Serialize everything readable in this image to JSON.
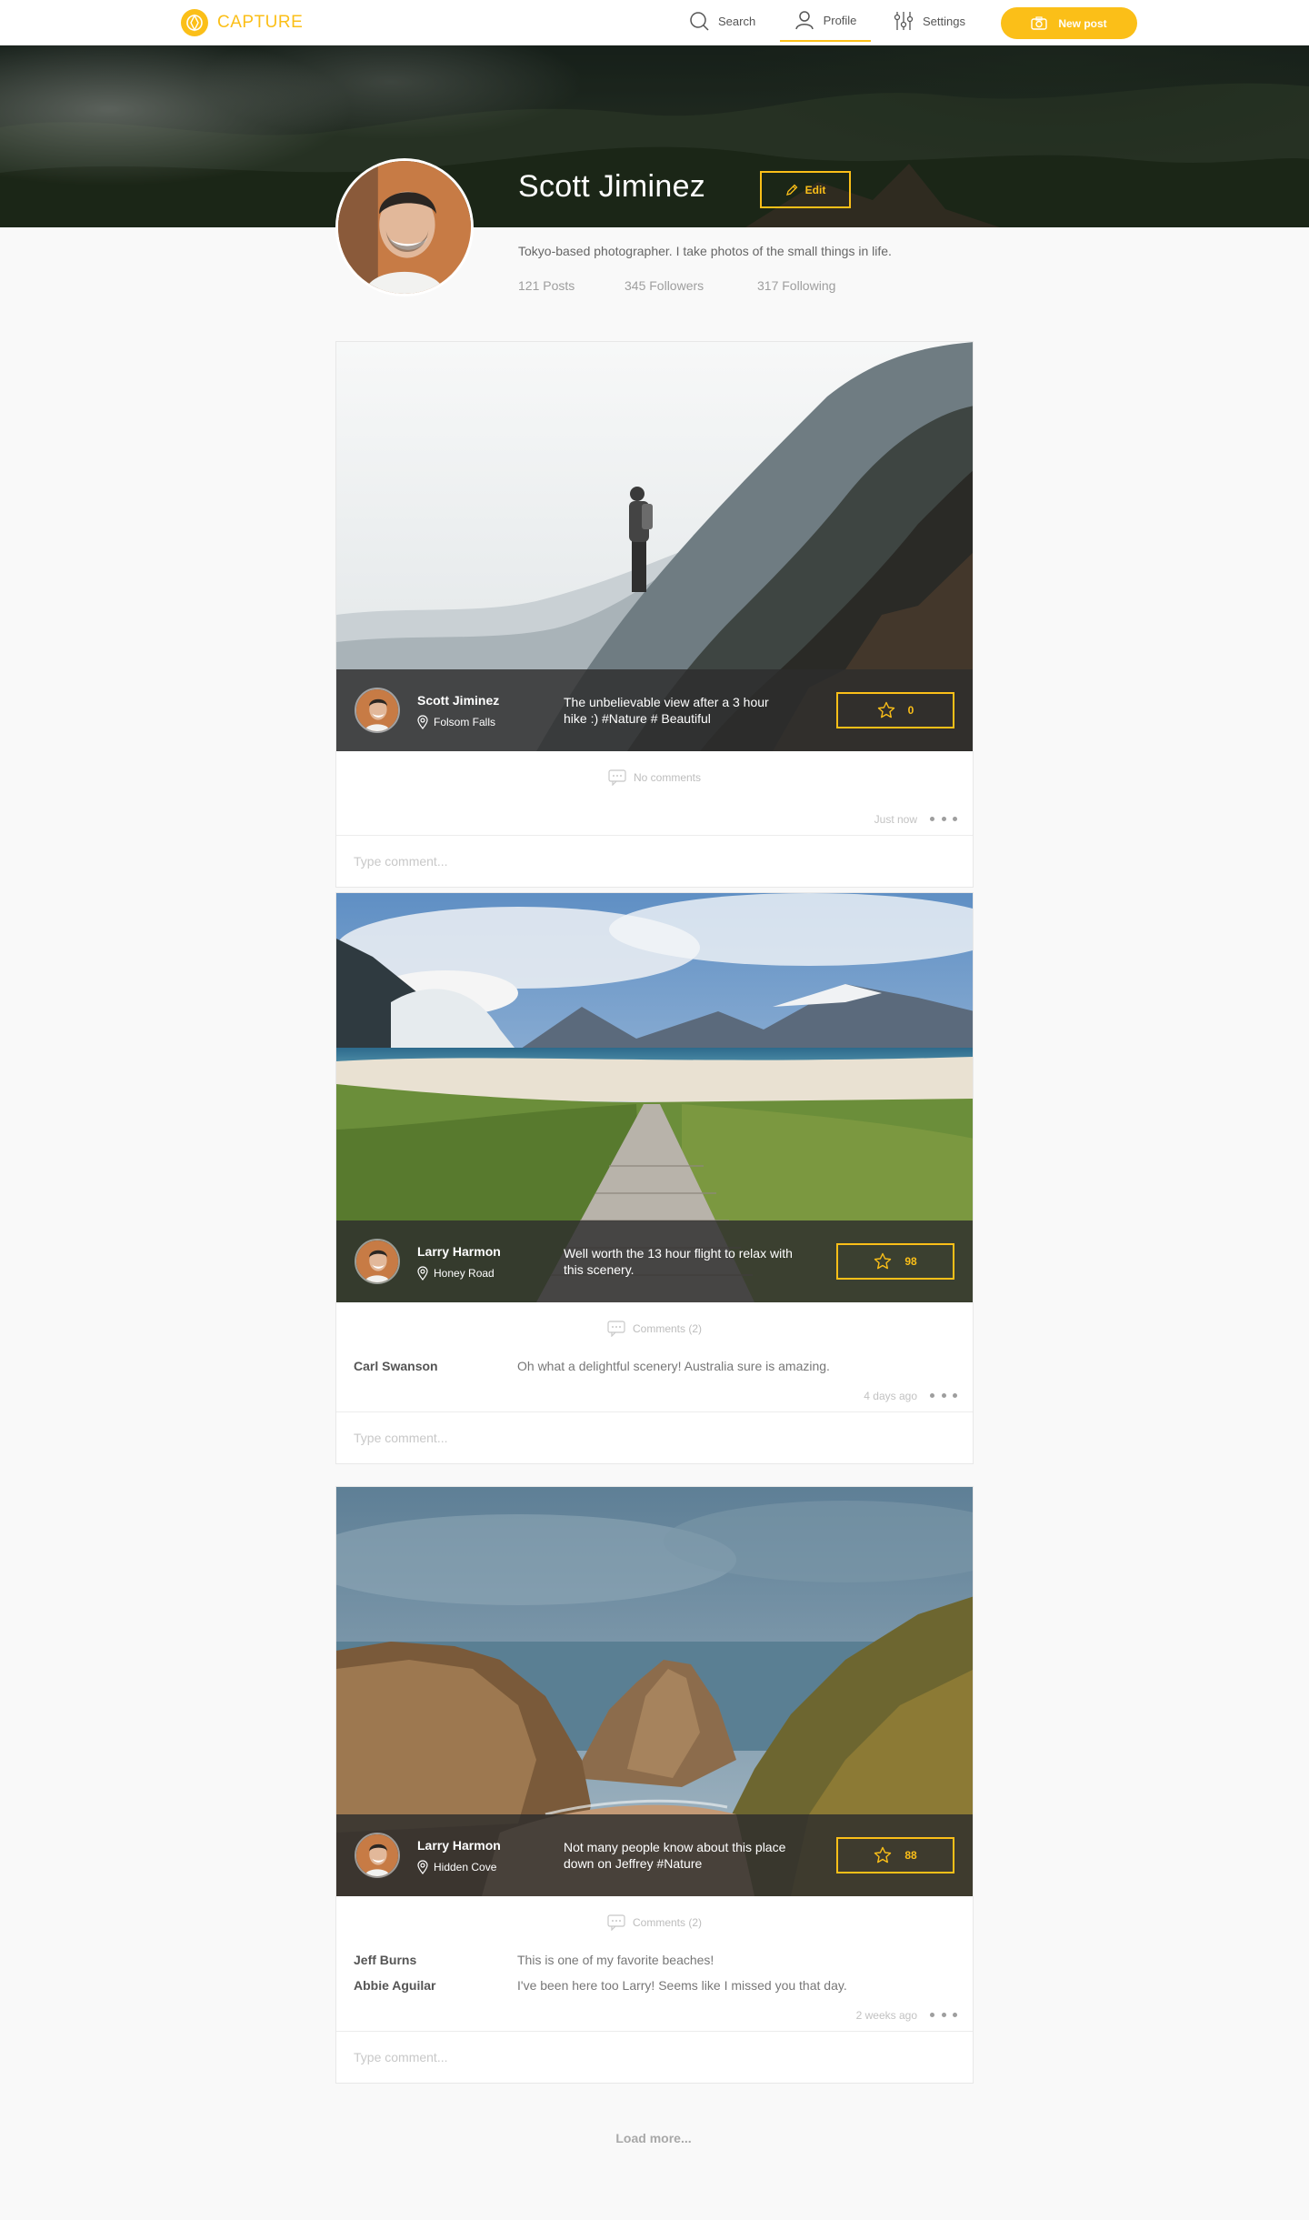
{
  "nav": {
    "brand": "CAPTURE",
    "search": "Search",
    "profile": "Profile",
    "settings": "Settings",
    "new_post": "New post",
    "accent_color": "#fbbf18"
  },
  "profile": {
    "name": "Scott Jiminez",
    "edit_label": "Edit",
    "bio": "Tokyo-based photographer. I take photos of the small things in life.",
    "posts": "121 Posts",
    "followers": "345 Followers",
    "following": "317 Following"
  },
  "posts": [
    {
      "author": "Scott Jiminez",
      "location": "Folsom Falls",
      "caption": "The unbelievable view after a 3 hour hike :) #Nature # Beautiful",
      "stars": "0",
      "comments_label": "No comments",
      "comments": [],
      "time": "Just now",
      "comment_placeholder": "Type comment..."
    },
    {
      "author": "Larry Harmon",
      "location": "Honey Road",
      "caption": "Well worth the 13 hour flight to relax with this scenery.",
      "stars": "98",
      "comments_label": "Comments (2)",
      "comments": [
        {
          "author": "Carl Swanson",
          "text": "Oh what a delightful scenery! Australia sure is amazing."
        }
      ],
      "time": "4 days ago",
      "comment_placeholder": "Type comment..."
    },
    {
      "author": "Larry Harmon",
      "location": "Hidden Cove",
      "caption": "Not many people know about this place down on Jeffrey #Nature",
      "stars": "88",
      "comments_label": "Comments (2)",
      "comments": [
        {
          "author": "Jeff Burns",
          "text": "This is one of my favorite beaches!"
        },
        {
          "author": "Abbie Aguilar",
          "text": "I've been here too Larry! Seems like I missed you that day."
        }
      ],
      "time": "2 weeks ago",
      "comment_placeholder": "Type comment..."
    }
  ],
  "load_more": "Load more..."
}
